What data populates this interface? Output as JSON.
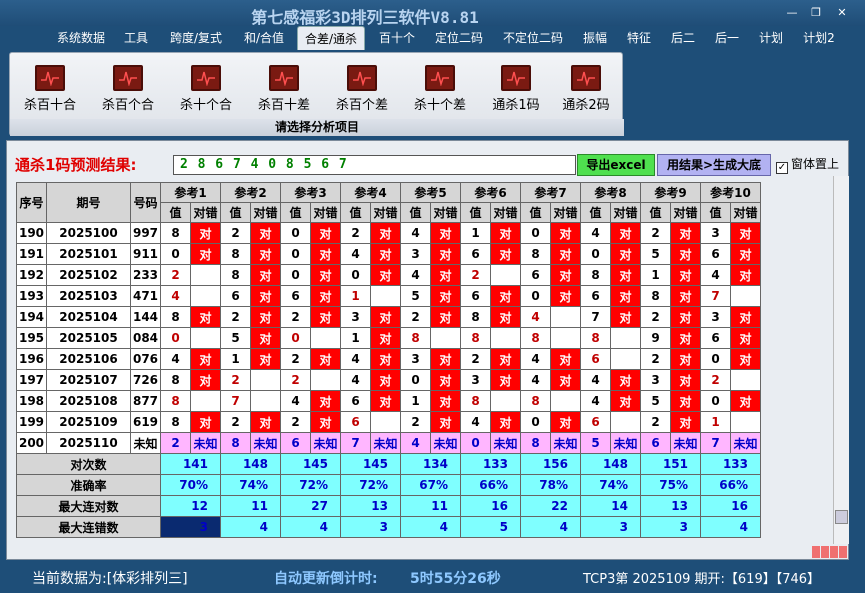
{
  "window": {
    "title": "第七感福彩3D排列三软件V8.81",
    "minimize": "—",
    "maximize": "❐",
    "close": "✕"
  },
  "menu": [
    {
      "label": "系统数据",
      "name": "menu-system-data"
    },
    {
      "label": "工具",
      "name": "menu-tools"
    },
    {
      "label": "跨度/复式",
      "name": "menu-span-compound"
    },
    {
      "label": "和/合值",
      "name": "menu-sum-value"
    },
    {
      "label": "合差/通杀",
      "name": "menu-diff-kill",
      "active": true
    },
    {
      "label": "百十个",
      "name": "menu-hundreds-tens-units"
    },
    {
      "label": "定位二码",
      "name": "menu-fixed-two-code"
    },
    {
      "label": "不定位二码",
      "name": "menu-unfixed-two-code"
    },
    {
      "label": "振幅",
      "name": "menu-amplitude"
    },
    {
      "label": "特征",
      "name": "menu-features"
    },
    {
      "label": "后二",
      "name": "menu-last-two"
    },
    {
      "label": "后一",
      "name": "menu-last-one"
    },
    {
      "label": "计划",
      "name": "menu-plan"
    },
    {
      "label": "计划2",
      "name": "menu-plan-2"
    }
  ],
  "ribbon": {
    "buttons": [
      {
        "label": "杀百十合",
        "name": "kill-hundred-ten-sum-button"
      },
      {
        "label": "杀百个合",
        "name": "kill-hundred-unit-sum-button"
      },
      {
        "label": "杀十个合",
        "name": "kill-ten-unit-sum-button"
      },
      {
        "label": "杀百十差",
        "name": "kill-hundred-ten-diff-button"
      },
      {
        "label": "杀百个差",
        "name": "kill-hundred-unit-diff-button"
      },
      {
        "label": "杀十个差",
        "name": "kill-ten-unit-diff-button"
      },
      {
        "label": "通杀1码",
        "name": "kill-one-code-button"
      },
      {
        "label": "通杀2码",
        "name": "kill-two-code-button"
      }
    ],
    "caption": "请选择分析项目"
  },
  "prediction": {
    "label": "通杀1码预测结果:",
    "value": "2 8 6 7 4 0 8 5 6 7",
    "export_label": "导出excel",
    "generate_label": "用结果>生成大底",
    "topmost_label": "窗体置上",
    "topmost_checked": "✓"
  },
  "table": {
    "headers": {
      "idx": "序号",
      "period": "期号",
      "number": "号码",
      "value": "值",
      "result": "对错"
    },
    "ref_groups": [
      "参考1",
      "参考2",
      "参考3",
      "参考4",
      "参考5",
      "参考6",
      "参考7",
      "参考8",
      "参考9",
      "参考10"
    ],
    "hit_label": "对",
    "unknown_label": "未知",
    "rows": [
      {
        "idx": "190",
        "period": "2025100",
        "number": "997",
        "vals": [
          "8",
          "2",
          "0",
          "2",
          "4",
          "1",
          "0",
          "4",
          "2",
          "3"
        ],
        "hits": [
          1,
          1,
          1,
          1,
          1,
          1,
          1,
          1,
          1,
          1
        ],
        "reds": [
          0,
          0,
          0,
          0,
          0,
          0,
          0,
          0,
          0,
          0
        ]
      },
      {
        "idx": "191",
        "period": "2025101",
        "number": "911",
        "vals": [
          "0",
          "8",
          "0",
          "4",
          "3",
          "6",
          "8",
          "0",
          "5",
          "6"
        ],
        "hits": [
          1,
          1,
          1,
          1,
          1,
          1,
          1,
          1,
          1,
          1
        ],
        "reds": [
          0,
          0,
          0,
          0,
          0,
          0,
          0,
          0,
          0,
          0
        ]
      },
      {
        "idx": "192",
        "period": "2025102",
        "number": "233",
        "vals": [
          "2",
          "8",
          "0",
          "0",
          "4",
          "2",
          "6",
          "8",
          "1",
          "4"
        ],
        "hits": [
          0,
          1,
          1,
          1,
          1,
          0,
          1,
          1,
          1,
          1
        ],
        "reds": [
          1,
          0,
          0,
          0,
          0,
          1,
          0,
          0,
          0,
          0
        ]
      },
      {
        "idx": "193",
        "period": "2025103",
        "number": "471",
        "vals": [
          "4",
          "6",
          "6",
          "1",
          "5",
          "6",
          "0",
          "6",
          "8",
          "7"
        ],
        "hits": [
          0,
          1,
          1,
          0,
          1,
          1,
          1,
          1,
          1,
          0
        ],
        "reds": [
          1,
          0,
          0,
          1,
          0,
          0,
          0,
          0,
          0,
          1
        ]
      },
      {
        "idx": "194",
        "period": "2025104",
        "number": "144",
        "vals": [
          "8",
          "2",
          "2",
          "3",
          "2",
          "8",
          "4",
          "7",
          "2",
          "3"
        ],
        "hits": [
          1,
          1,
          1,
          1,
          1,
          1,
          0,
          1,
          1,
          1
        ],
        "reds": [
          0,
          0,
          0,
          0,
          0,
          0,
          1,
          0,
          0,
          0
        ]
      },
      {
        "idx": "195",
        "period": "2025105",
        "number": "084",
        "vals": [
          "0",
          "5",
          "0",
          "1",
          "8",
          "8",
          "8",
          "8",
          "9",
          "6"
        ],
        "hits": [
          0,
          1,
          0,
          1,
          0,
          0,
          0,
          0,
          1,
          1
        ],
        "reds": [
          1,
          0,
          1,
          0,
          1,
          1,
          1,
          1,
          0,
          0
        ]
      },
      {
        "idx": "196",
        "period": "2025106",
        "number": "076",
        "vals": [
          "4",
          "1",
          "2",
          "4",
          "3",
          "2",
          "4",
          "6",
          "2",
          "0"
        ],
        "hits": [
          1,
          1,
          1,
          1,
          1,
          1,
          1,
          0,
          1,
          1
        ],
        "reds": [
          0,
          0,
          0,
          0,
          0,
          0,
          0,
          1,
          0,
          0
        ]
      },
      {
        "idx": "197",
        "period": "2025107",
        "number": "726",
        "vals": [
          "8",
          "2",
          "2",
          "4",
          "0",
          "3",
          "4",
          "4",
          "3",
          "2"
        ],
        "hits": [
          1,
          0,
          0,
          1,
          1,
          1,
          1,
          1,
          1,
          0
        ],
        "reds": [
          0,
          1,
          1,
          0,
          0,
          0,
          0,
          0,
          0,
          1
        ]
      },
      {
        "idx": "198",
        "period": "2025108",
        "number": "877",
        "vals": [
          "8",
          "7",
          "4",
          "6",
          "1",
          "8",
          "8",
          "4",
          "5",
          "0"
        ],
        "hits": [
          0,
          0,
          1,
          1,
          1,
          0,
          0,
          1,
          1,
          1
        ],
        "reds": [
          1,
          1,
          0,
          0,
          0,
          1,
          1,
          0,
          0,
          0
        ]
      },
      {
        "idx": "199",
        "period": "2025109",
        "number": "619",
        "vals": [
          "8",
          "2",
          "2",
          "6",
          "2",
          "4",
          "0",
          "6",
          "2",
          "1"
        ],
        "hits": [
          1,
          1,
          1,
          0,
          1,
          1,
          1,
          0,
          1,
          0
        ],
        "reds": [
          0,
          0,
          0,
          1,
          0,
          0,
          0,
          1,
          0,
          1
        ]
      }
    ],
    "pending": {
      "idx": "200",
      "period": "2025110",
      "number": "未知",
      "vals": [
        "2",
        "8",
        "6",
        "7",
        "4",
        "0",
        "8",
        "5",
        "6",
        "7"
      ]
    },
    "stats": [
      {
        "label": "对次数",
        "values": [
          "141",
          "148",
          "145",
          "145",
          "134",
          "133",
          "156",
          "148",
          "151",
          "133"
        ]
      },
      {
        "label": "准确率",
        "values": [
          "70%",
          "74%",
          "72%",
          "72%",
          "67%",
          "66%",
          "78%",
          "74%",
          "75%",
          "66%"
        ]
      },
      {
        "label": "最大连对数",
        "values": [
          "12",
          "11",
          "27",
          "13",
          "11",
          "16",
          "22",
          "14",
          "13",
          "16"
        ]
      },
      {
        "label": "最大连错数",
        "values": [
          "3",
          "4",
          "4",
          "3",
          "4",
          "5",
          "4",
          "3",
          "3",
          "4"
        ]
      }
    ]
  },
  "status": {
    "current_data": "当前数据为:[体彩排列三]",
    "countdown_label": "自动更新倒计时:",
    "countdown_value": "5时55分26秒",
    "tcp_info": "TCP3第 2025109 期开:【619】【746】"
  },
  "colors": {
    "hit": "#ff0000",
    "pending": "#ffb6ff",
    "stat": "#7fffff",
    "frame": "#1e4e78"
  }
}
